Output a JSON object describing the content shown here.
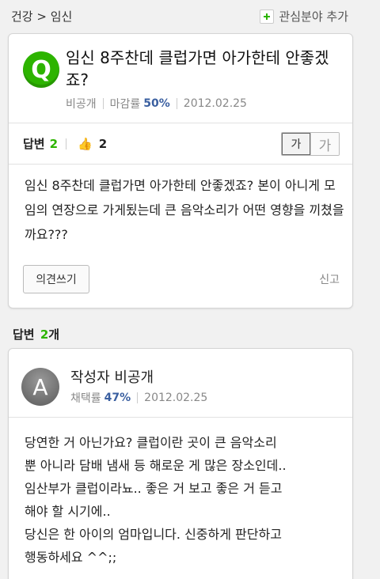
{
  "header": {
    "breadcrumb": "건강 > 임신",
    "interest_label": "관심분야 추가"
  },
  "question": {
    "badge": "Q",
    "title": "임신 8주찬데 클럽가면 아가한테 안좋겠죠?",
    "author": "비공개",
    "deadline_label": "마감률",
    "deadline_value": "50%",
    "date": "2012.02.25",
    "answers_label": "답변",
    "answers_count": "2",
    "likes_count": "2",
    "font_small": "가",
    "font_large": "가",
    "body": "임신 8주찬데 클럽가면 아가한테 안좋겠죠? 본이 아니게 모임의 연장으로 가게됬는데 큰 음악소리가 어떤 영향을 끼쳤을까요???",
    "opinion_button": "의견쓰기",
    "report": "신고"
  },
  "answers_section": {
    "label": "답변",
    "count": "2",
    "unit": "개"
  },
  "answer": {
    "avatar_letter": "A",
    "author": "작성자 비공개",
    "adopt_label": "채택률",
    "adopt_value": "47%",
    "date": "2012.02.25",
    "body": "당연한 거 아닌가요? 클럽이란 곳이 큰 음악소리\n뿐 아니라 담배 냄새 등 해로운 게 많은 장소인데..\n임산부가 클럽이라뇨.. 좋은 거 보고 좋은 거 듣고\n해야 할 시기에..\n당신은 한 아이의 엄마입니다. 신중하게 판단하고\n행동하세요 ^^;;"
  },
  "colors": {
    "accent_green": "#2db400",
    "rate_blue": "#3a5fa0"
  }
}
